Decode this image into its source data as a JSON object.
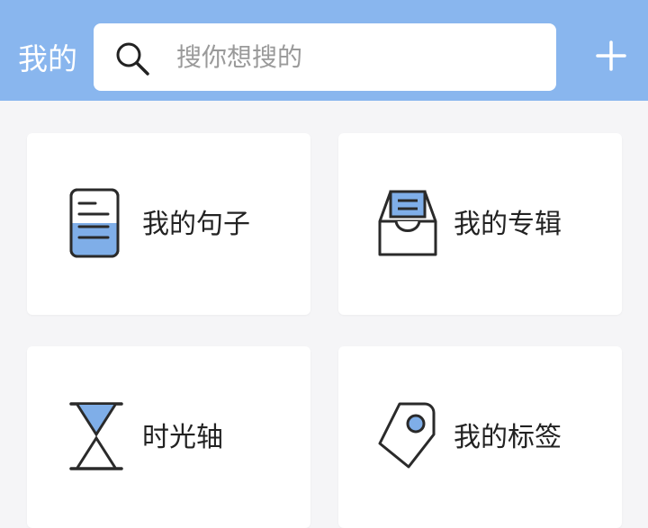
{
  "header": {
    "title": "我的",
    "search_placeholder": "搜你想搜的",
    "search_icon": "search-icon",
    "add_icon": "plus-icon"
  },
  "cards": [
    {
      "label": "我的句子",
      "icon": "document-icon"
    },
    {
      "label": "我的专辑",
      "icon": "inbox-tray-icon"
    },
    {
      "label": "时光轴",
      "icon": "hourglass-icon"
    },
    {
      "label": "我的标签",
      "icon": "tag-icon"
    }
  ],
  "colors": {
    "header_bg": "#89b6ee",
    "accent": "#7faee8",
    "icon_stroke": "#2a2a2a",
    "page_bg": "#f5f5f7"
  }
}
